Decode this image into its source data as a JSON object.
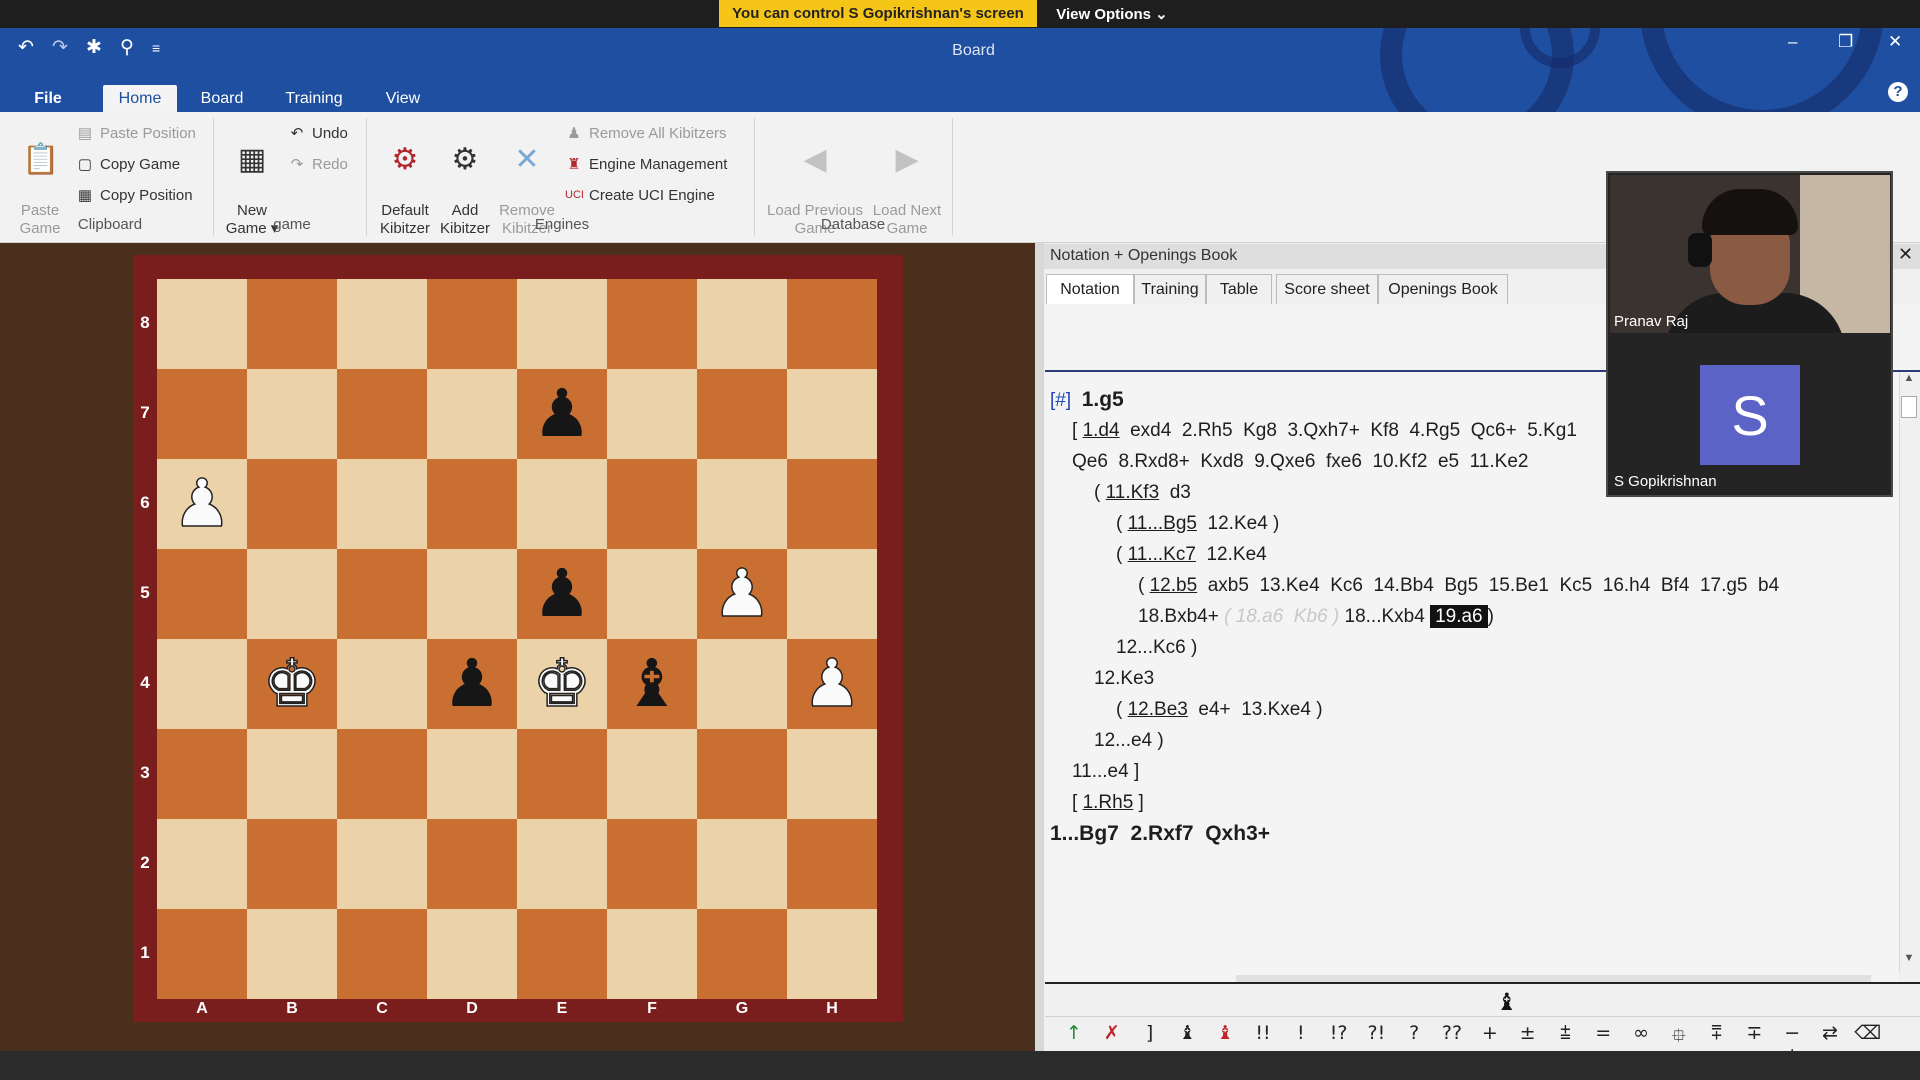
{
  "share_banner": {
    "message": "You can control S Gopikrishnan's screen",
    "view_options": "View Options ⌄"
  },
  "window": {
    "title": "Board",
    "minimize": "–",
    "restore": "❐",
    "close": "✕"
  },
  "quick_access": {
    "undo_icon": "↶",
    "redo_icon": "↷",
    "gear_icon": "✱",
    "pin_icon": "⚲",
    "more_icon": "≡"
  },
  "ribbon_tabs": [
    "File",
    "Home",
    "Board",
    "Training",
    "View"
  ],
  "ribbon": {
    "clipboard": {
      "group_label": "Clipboard",
      "paste_game": "Paste\nGame",
      "paste_position": "Paste Position",
      "copy_game": "Copy Game",
      "copy_position": "Copy Position"
    },
    "game": {
      "group_label": "game",
      "new_game": "New\nGame ▾",
      "undo": "Undo",
      "redo": "Redo"
    },
    "engines": {
      "group_label": "Engines",
      "default_kibitzer": "Default\nKibitzer",
      "add_kibitzer": "Add\nKibitzer",
      "remove_kibitzer": "Remove\nKibitzer",
      "remove_all_kibitzers": "Remove All Kibitzers",
      "engine_management": "Engine Management",
      "create_uci_engine": "Create UCI Engine"
    },
    "database": {
      "group_label": "Database",
      "load_previous": "Load Previous\nGame",
      "load_next": "Load Next\nGame"
    }
  },
  "board": {
    "ranks": [
      "8",
      "7",
      "6",
      "5",
      "4",
      "3",
      "2",
      "1"
    ],
    "files": [
      "A",
      "B",
      "C",
      "D",
      "E",
      "F",
      "G",
      "H"
    ],
    "pieces": [
      {
        "square": "e7",
        "glyph": "♟",
        "color": "black"
      },
      {
        "square": "a6",
        "glyph": "♟",
        "color": "white"
      },
      {
        "square": "e5",
        "glyph": "♟",
        "color": "black"
      },
      {
        "square": "g5",
        "glyph": "♟",
        "color": "white"
      },
      {
        "square": "b4",
        "glyph": "♚",
        "color": "white"
      },
      {
        "square": "d4",
        "glyph": "♟",
        "color": "black"
      },
      {
        "square": "e4",
        "glyph": "♚",
        "color": "white"
      },
      {
        "square": "f4",
        "glyph": "♝",
        "color": "black"
      },
      {
        "square": "h4",
        "glyph": "♟",
        "color": "white"
      }
    ]
  },
  "notation_panel": {
    "title": "Notation + Openings Book",
    "close": "✕",
    "tabs": [
      "Notation",
      "Training",
      "Table",
      "Score sheet",
      "Openings Book"
    ],
    "lines": {
      "l1_tag": "[#]",
      "l1_move": "1.g5",
      "l2": [
        "[",
        "1.d4",
        " exd4  2.Rh5  Kg8  3.Qxh7+  Kf8  4.Rg5  Qc6+  5.Kg1"
      ],
      "l3": "Qe6  8.Rxd8+  Kxd8  9.Qxe6  fxe6  10.Kf2  e5  11.Ke2",
      "l4": [
        "(",
        "11.Kf3",
        " d3"
      ],
      "l5": [
        "(",
        "11...Bg5",
        " 12.Ke4 )"
      ],
      "l6": [
        "(",
        "11...Kc7",
        " 12.Ke4"
      ],
      "l7": [
        "(",
        "12.b5",
        " axb5  13.Ke4  Kc6  14.Bb4  Bg5  15.Be1  Kc5  16.h4  Bf4  17.g5  b4"
      ],
      "l8": [
        "18.Bxb4+ ",
        "( 18.a6  Kb6 )",
        " 18...Kxb4 ",
        "19.a6",
        ")"
      ],
      "l9": "12...Kc6 )",
      "l10": "12.Ke3",
      "l11": [
        "(",
        "12.Be3",
        " e4+  13.Kxe4 )"
      ],
      "l12": "12...e4 )",
      "l13": "11...e4 ]",
      "l14": [
        "[",
        "1.Rh5",
        "]"
      ],
      "l15": "1...Bg7  2.Rxf7  Qxh3+"
    },
    "annotations": [
      "↑",
      "✗",
      "]",
      "♝",
      "♝",
      "!!",
      "!",
      "!?",
      "?!",
      "?",
      "??",
      "+−",
      "±",
      "⩲",
      "=",
      "∞",
      "⯐",
      "⩱",
      "∓",
      "−+",
      "⇄",
      "⌫"
    ]
  },
  "video": {
    "participant1": "Pranav Raj",
    "participant2": "S Gopikrishnan",
    "avatar_letter": "S"
  },
  "colors": {
    "title_blue": "#1f4fa0",
    "banner_yellow": "#f5c518",
    "light_square": "#ecd2a9",
    "dark_square": "#c96f32",
    "frame": "#7a1d1d",
    "avatar": "#5b63c6"
  }
}
